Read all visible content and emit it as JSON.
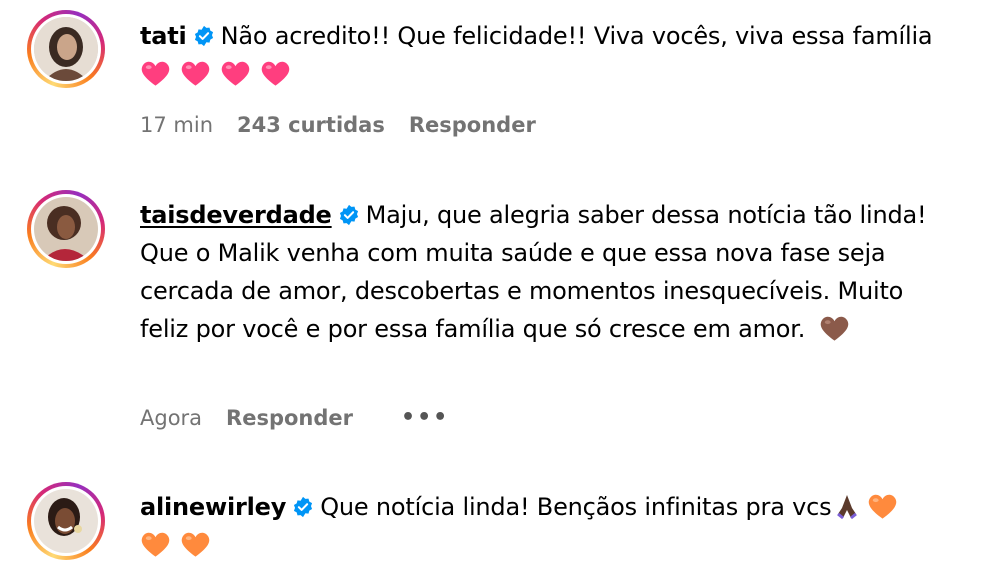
{
  "comments": [
    {
      "username": "tati",
      "text": "Não acredito!! Que felicidade!! Viva vocês, viva essa família",
      "emoji": "pink-heart x4",
      "time": "17 min",
      "likes": "243 curtidas",
      "reply": "Responder"
    },
    {
      "username": "taisdeverdade",
      "text": "Maju, que alegria saber dessa notícia tão linda! Que o Malik venha com muita saúde e que essa nova fase seja cercada de amor, descobertas e momentos inesquecíveis. Muito feliz por você e por essa família que só cresce em amor.",
      "emoji": "brown-heart",
      "time": "Agora",
      "reply": "Responder",
      "more": "•••"
    },
    {
      "username": "alinewirley",
      "text": "Que notícia linda! Bençãos infinitas pra vcs",
      "emoji": "praying-hands, orange-heart x3"
    }
  ],
  "colors": {
    "verified": "#0095f6",
    "meta": "#737373",
    "pink_heart": "#ff3e7f",
    "brown_heart": "#8b5a4a",
    "orange_heart": "#ff8a3d"
  }
}
